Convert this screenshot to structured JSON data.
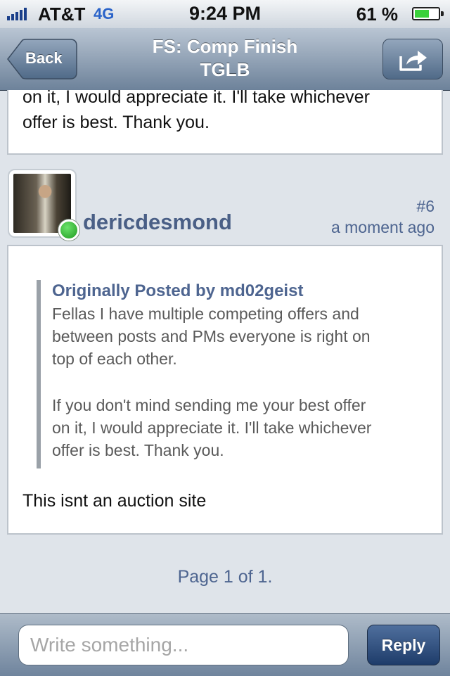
{
  "status_bar": {
    "carrier": "AT&T",
    "network": "4G",
    "time": "9:24 PM",
    "battery_percent": "61 %",
    "battery_level": 0.61
  },
  "nav": {
    "back_label": "Back",
    "title_line1": "FS: Comp Finish",
    "title_line2": "TGLB"
  },
  "previous_post": {
    "line1": "on it, I would appreciate it. I'll take whichever",
    "line2": "offer is best. Thank you."
  },
  "post": {
    "username": "dericdesmond",
    "number": "#6",
    "time": "a moment ago",
    "quote": {
      "header": "Originally Posted by md02geist",
      "para1_line1": "Fellas I have multiple competing offers and",
      "para1_line2": "between posts and PMs everyone is right on",
      "para1_line3": "top of each other.",
      "para2_line1": "If you don't mind sending me your best offer",
      "para2_line2": "on it, I would appreciate it. I'll take whichever",
      "para2_line3": "offer is best. Thank you."
    },
    "body": "This isnt an auction site"
  },
  "pager": "Page 1 of 1.",
  "compose": {
    "placeholder": "Write something...",
    "reply_label": "Reply"
  }
}
